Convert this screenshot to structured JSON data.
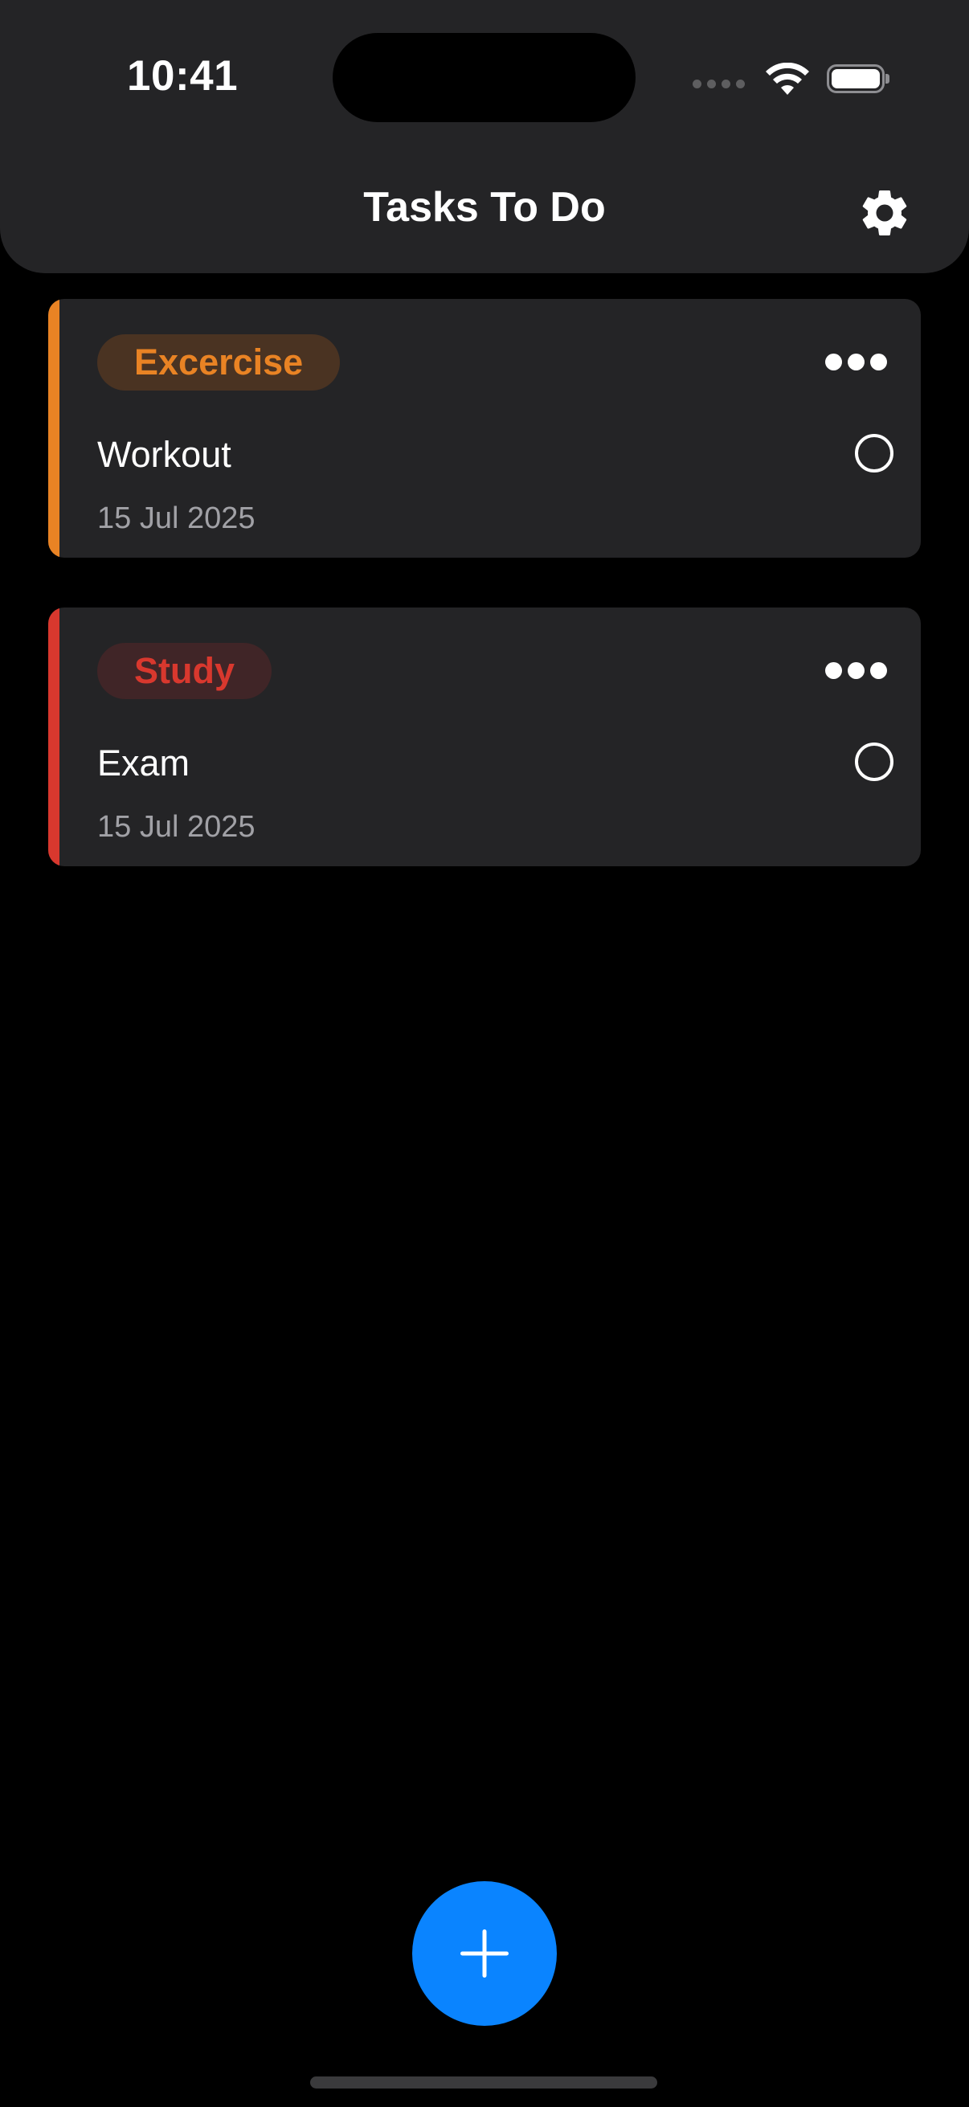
{
  "status_bar": {
    "time": "10:41",
    "icons": [
      "cellular-signal-icon",
      "wifi-icon",
      "battery-icon"
    ]
  },
  "header": {
    "title": "Tasks To Do",
    "settings_icon": "gear-icon"
  },
  "tasks": [
    {
      "category": "Excercise",
      "title": "Workout",
      "date": "15 Jul 2025",
      "completed": false,
      "accent_color": "#e98324",
      "badge_bg": "#4a3322"
    },
    {
      "category": "Study",
      "title": "Exam",
      "date": "15 Jul 2025",
      "completed": false,
      "accent_color": "#d8382e",
      "badge_bg": "#402527"
    }
  ],
  "add_button": {
    "icon": "plus-icon",
    "color": "#0a84ff"
  },
  "colors": {
    "background": "#000000",
    "surface": "#242426",
    "secondary_text": "#a1a1a6"
  }
}
